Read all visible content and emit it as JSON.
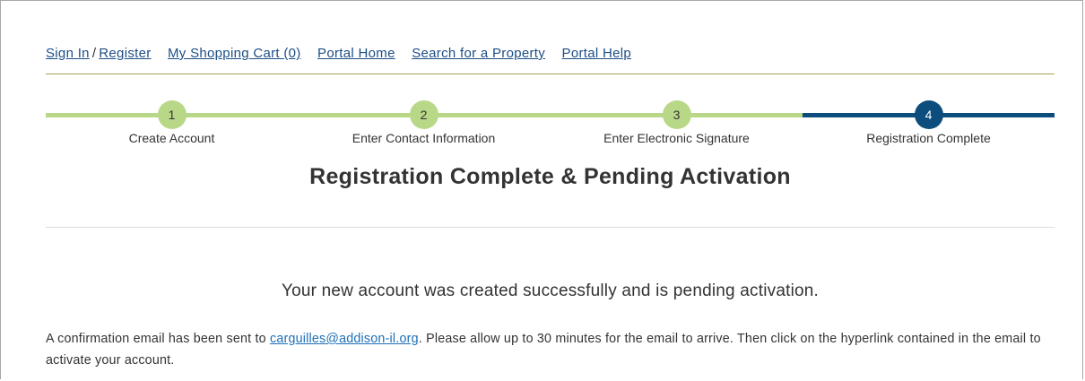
{
  "nav": {
    "sign_in": "Sign In",
    "separator": "/",
    "register": "Register",
    "cart": "My Shopping Cart (0)",
    "portal_home": "Portal Home",
    "search_property": "Search for a Property",
    "portal_help": "Portal Help"
  },
  "progress": {
    "current_step": 4,
    "steps": [
      {
        "number": "1",
        "label": "Create Account",
        "status": "done"
      },
      {
        "number": "2",
        "label": "Enter Contact Information",
        "status": "done"
      },
      {
        "number": "3",
        "label": "Enter Electronic Signature",
        "status": "done"
      },
      {
        "number": "4",
        "label": "Registration Complete",
        "status": "current"
      }
    ]
  },
  "main": {
    "title": "Registration Complete & Pending Activation",
    "success_message": "Your new account was created successfully and is pending activation.",
    "confirm_prefix": "A confirmation email has been sent to ",
    "email": "carguilles@addison-il.org",
    "confirm_suffix": ". Please allow up to 30 minutes for the email to arrive. Then click on the hyperlink contained in the email to activate your account."
  },
  "colors": {
    "link": "#1d4e86",
    "step_done": "#b8d888",
    "step_current": "#0d4d7d",
    "nav_rule": "#a8a35a"
  }
}
